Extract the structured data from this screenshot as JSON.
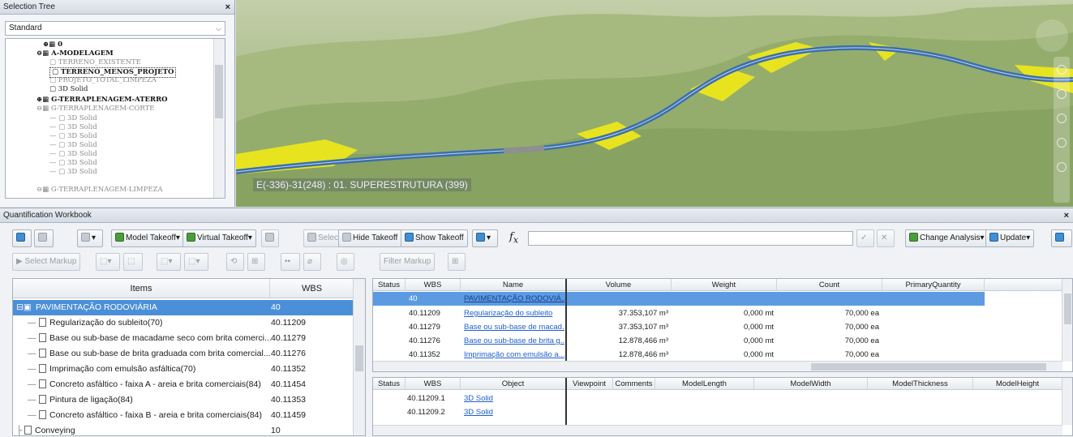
{
  "selection_tree": {
    "title": "Selection Tree",
    "combo_value": "Standard",
    "nodes": [
      {
        "label": "0",
        "style": "bold"
      },
      {
        "label": "A-MODELAGEM",
        "style": "bold"
      },
      {
        "label": "TERRENO_EXISTENTE",
        "style": "gray"
      },
      {
        "label": "TERRENO_MENOS_PROJETO",
        "style": "sel"
      },
      {
        "label": "PROJETO_TOTAL_LIMPEZA",
        "style": "gray"
      },
      {
        "label": "3D Solid",
        "style": "normal"
      },
      {
        "label": "G-TERRAPLENAGEM-ATERRO",
        "style": "bold"
      },
      {
        "label": "G-TERRAPLENAGEM-CORTE",
        "style": "gray"
      },
      {
        "label": "3D Solid",
        "style": "gray"
      },
      {
        "label": "3D Solid",
        "style": "gray"
      },
      {
        "label": "3D Solid",
        "style": "gray"
      },
      {
        "label": "3D Solid",
        "style": "gray"
      },
      {
        "label": "3D Solid",
        "style": "gray"
      },
      {
        "label": "3D Solid",
        "style": "gray"
      },
      {
        "label": "3D Solid",
        "style": "gray"
      },
      {
        "label": "G-TERRAPLENAGEM-LIMPEZA",
        "style": "gray"
      }
    ]
  },
  "viewport": {
    "label": "E(-336)-31(248) : 01. SUPERESTRUTURA (399)",
    "colors": {
      "terrain": "#9fb27a",
      "road": "#3a6fb0",
      "fill": "#e8e520"
    }
  },
  "workbook": {
    "title": "Quantification Workbook",
    "toolbar": {
      "model_takeoff": "Model Takeoff",
      "virtual_takeoff": "Virtual Takeoff",
      "select": "Select",
      "hide_takeoff": "Hide Takeoff",
      "show_takeoff": "Show Takeoff",
      "change_analysis": "Change Analysis",
      "update": "Update",
      "select_markup": "Select Markup",
      "filter_markup": "Filter Markup"
    },
    "items_panel": {
      "headers": [
        "Items",
        "WBS"
      ],
      "rows": [
        {
          "name": "PAVIMENTAÇÃO RODOVIÁRIA",
          "wbs": "40"
        },
        {
          "name": "Regularização do subleito(70)",
          "wbs": "40.11209"
        },
        {
          "name": "Base ou sub-base de macadame seco com brita comerci...",
          "wbs": "40.11279"
        },
        {
          "name": "Base ou sub-base de brita graduada com brita comercial...",
          "wbs": "40.11276"
        },
        {
          "name": "Imprimação com emulsão asfáltica(70)",
          "wbs": "40.11352"
        },
        {
          "name": "Concreto asfáltico - faixa A - areia e brita comerciais(84)",
          "wbs": "40.11454"
        },
        {
          "name": "Pintura de ligação(84)",
          "wbs": "40.11353"
        },
        {
          "name": "Concreto asfáltico - faixa B - areia e brita comerciais(84)",
          "wbs": "40.11459"
        },
        {
          "name": "Conveying",
          "wbs": "10"
        }
      ]
    },
    "takeoff_grid": {
      "headers": [
        "Status",
        "WBS",
        "Name",
        "Volume",
        "Weight",
        "Count",
        "PrimaryQuantity"
      ],
      "rows": [
        {
          "wbs": "40",
          "name": "PAVIMENTAÇÃO RODOVIÁ...",
          "volume": "",
          "weight": "",
          "count": ""
        },
        {
          "wbs": "40.11209",
          "name": "Regularização do subleito",
          "volume": "37.353,107 m³",
          "weight": "0,000 mt",
          "count": "70,000 ea"
        },
        {
          "wbs": "40.11279",
          "name": "Base ou sub-base de macad...",
          "volume": "37.353,107 m³",
          "weight": "0,000 mt",
          "count": "70,000 ea"
        },
        {
          "wbs": "40.11276",
          "name": "Base ou sub-base de brita g...",
          "volume": "12.878,466 m³",
          "weight": "0,000 mt",
          "count": "70,000 ea"
        },
        {
          "wbs": "40.11352",
          "name": "Imprimação com emulsão a...",
          "volume": "12.878,466 m³",
          "weight": "0,000 mt",
          "count": "70,000 ea"
        }
      ]
    },
    "object_grid": {
      "headers": [
        "Status",
        "WBS",
        "Object",
        "Viewpoint",
        "Comments",
        "ModelLength",
        "ModelWidth",
        "ModelThickness",
        "ModelHeight"
      ],
      "rows": [
        {
          "wbs": "40.11209.1",
          "object": "3D Solid"
        },
        {
          "wbs": "40.11209.2",
          "object": "3D Solid"
        }
      ]
    }
  }
}
